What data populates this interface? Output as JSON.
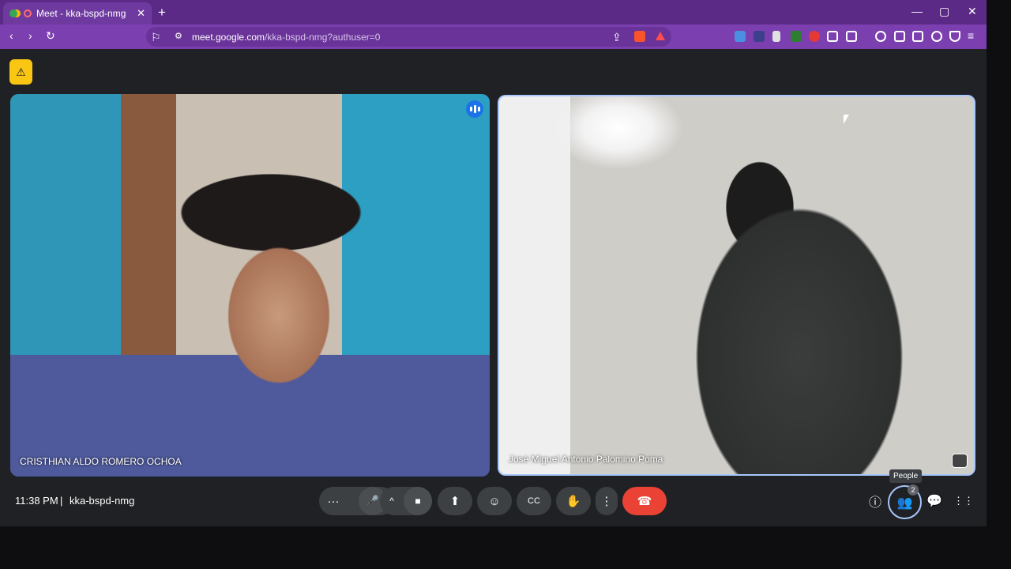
{
  "browser": {
    "tab_title": "Meet - kka-bspd-nmg",
    "tab_close": "✕",
    "new_tab": "+",
    "url_host": "meet.google.com",
    "url_path": "/kka-bspd-nmg?authuser=0",
    "controls": {
      "minimize": "—",
      "maximize": "▢",
      "close": "✕"
    },
    "nav": {
      "back": "‹",
      "forward": "›",
      "reload": "↻",
      "bookmark": "⚐",
      "share": "⇪"
    }
  },
  "meet": {
    "badge_icon": "⚠",
    "participants": [
      {
        "name": "CRISTHIAN ALDO ROMERO OCHOA"
      },
      {
        "name": "José Miguel Antonio Palomino Poma"
      }
    ],
    "time": "11:38 PM",
    "separator": "|",
    "meeting_code": "kka-bspd-nmg",
    "controls": {
      "more_audio": "···",
      "mic": "🎤",
      "video_options": "^",
      "camera": "■",
      "present": "⬆",
      "emoji": "☺",
      "captions": "CC",
      "hand": "✋",
      "more": "⋮",
      "end": "☎"
    },
    "right": {
      "info": "ⓘ",
      "people": "👥",
      "people_count": "2",
      "people_tooltip": "People",
      "chat": "💬",
      "activities": "⋮⋮"
    }
  }
}
